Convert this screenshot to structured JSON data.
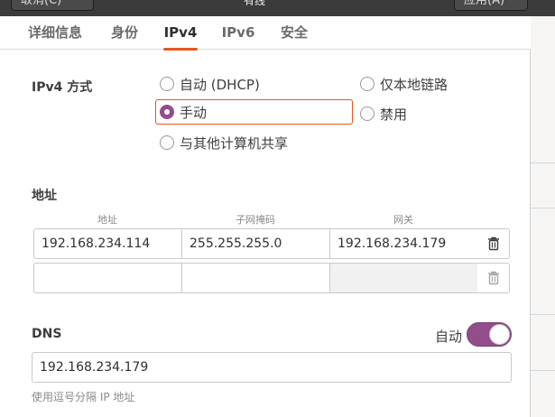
{
  "header": {
    "left_button": "取消(C)",
    "right_button": "应用(A)",
    "title": "有线"
  },
  "tabs": [
    {
      "label": "详细信息"
    },
    {
      "label": "身份"
    },
    {
      "label": "IPv4"
    },
    {
      "label": "IPv6"
    },
    {
      "label": "安全"
    }
  ],
  "ipv4": {
    "method_label": "IPv4 方式",
    "options": {
      "auto": "自动 (DHCP)",
      "link_local": "仅本地链路",
      "manual": "手动",
      "disabled": "禁用",
      "shared": "与其他计算机共享"
    },
    "selected": "manual"
  },
  "address": {
    "section_label": "地址",
    "columns": {
      "address": "地址",
      "netmask": "子网掩码",
      "gateway": "网关"
    },
    "rows": [
      {
        "address": "192.168.234.114",
        "netmask": "255.255.255.0",
        "gateway": "192.168.234.179"
      },
      {
        "address": "",
        "netmask": "",
        "gateway": ""
      }
    ]
  },
  "dns": {
    "label": "DNS",
    "auto_label": "自动",
    "auto_enabled": true,
    "value": "192.168.234.179",
    "hint": "使用逗号分隔 IP 地址"
  },
  "colors": {
    "accent": "#924d8b",
    "focus": "#e95420"
  }
}
